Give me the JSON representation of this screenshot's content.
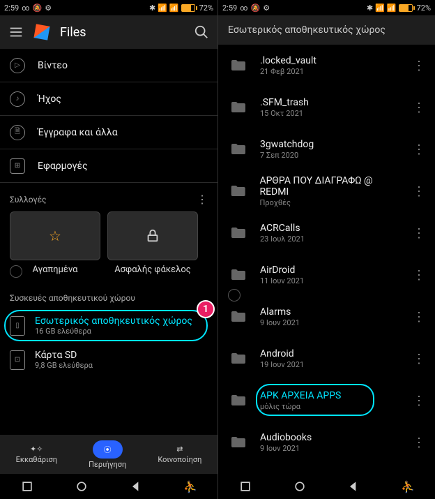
{
  "status": {
    "time": "2:59",
    "battery": "72%"
  },
  "left": {
    "app_title": "Files",
    "categories": [
      {
        "label": "Βίντεο"
      },
      {
        "label": "Ήχος"
      },
      {
        "label": "Έγγραφα και άλλα"
      },
      {
        "label": "Εφαρμογές"
      }
    ],
    "collections_label": "Συλλογές",
    "tile_favorites": "Αγαπημένα",
    "tile_safe": "Ασφαλής φάκελος",
    "storage_devices_label": "Συσκευές αποθηκευτικού χώρου",
    "internal": {
      "title": "Εσωτερικός αποθηκευτικός χώρος",
      "sub": "16 GB ελεύθερα"
    },
    "sd": {
      "title": "Κάρτα SD",
      "sub": "9,8 GB ελεύθερα"
    },
    "badge": "1",
    "nav": {
      "clean": "Εκκαθάριση",
      "browse": "Περιήγηση",
      "share": "Κοινοποίηση"
    }
  },
  "right": {
    "title": "Εσωτερικός αποθηκευτικός χώρος",
    "folders": [
      {
        "name": ".locked_vault",
        "date": "21 Φεβ 2021"
      },
      {
        "name": ".SFM_trash",
        "date": "15 Οκτ 2021"
      },
      {
        "name": "3gwatchdog",
        "date": "7 Σεπ 2020"
      },
      {
        "name": "ΑΡΘΡΑ ΠΟΥ ΔΙΑΓΡΑΦΩ @ REDMI",
        "date": "Προχθές"
      },
      {
        "name": "ACRCalls",
        "date": "23 Ιουλ 2021"
      },
      {
        "name": "AirDroid",
        "date": "11 Ιουν 2021"
      },
      {
        "name": "Alarms",
        "date": "9 Ιουν 2021"
      },
      {
        "name": "Android",
        "date": "19 Ιουν 2021"
      },
      {
        "name": "APK ΑΡΧΕΙΑ APPS",
        "date": "μόλις τώρα",
        "hl": true
      },
      {
        "name": "Audiobooks",
        "date": "9 Ιουν 2021"
      }
    ]
  }
}
